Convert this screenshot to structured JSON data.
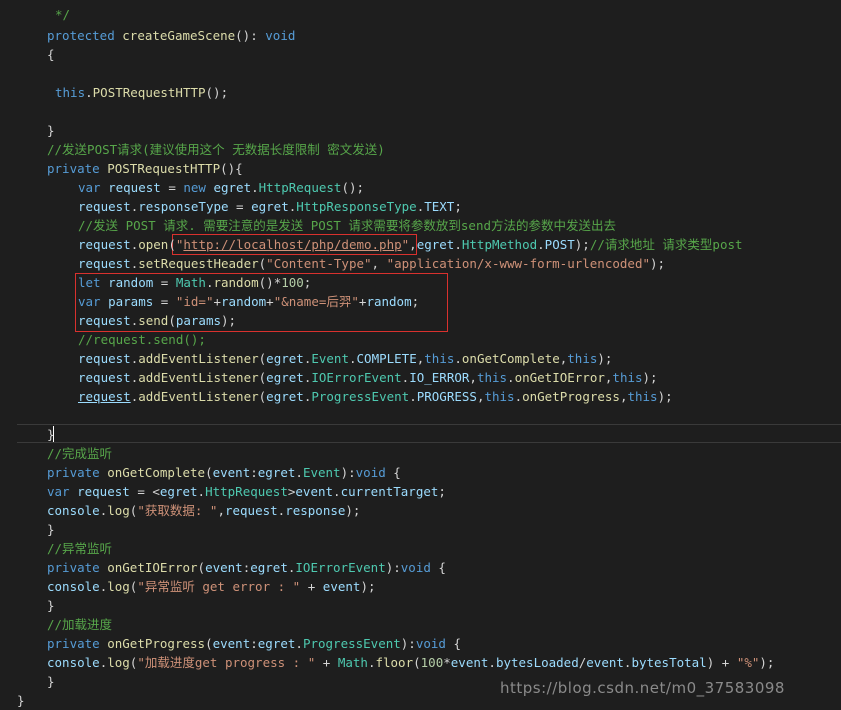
{
  "code": {
    "lines": [
      {
        "tokens": [
          {
            "t": "*/",
            "c": "cm"
          }
        ]
      },
      {
        "tokens": [
          {
            "t": "protected",
            "c": "kw"
          },
          {
            "t": " ",
            "c": "pl"
          },
          {
            "t": "createGameScene",
            "c": "fn"
          },
          {
            "t": "(): ",
            "c": "pl"
          },
          {
            "t": "void",
            "c": "kw"
          }
        ]
      },
      {
        "tokens": [
          {
            "t": "{",
            "c": "pl"
          }
        ]
      },
      {
        "tokens": []
      },
      {
        "tokens": [
          {
            "t": "this",
            "c": "kw"
          },
          {
            "t": ".",
            "c": "pl"
          },
          {
            "t": "POSTRequestHTTP",
            "c": "fn"
          },
          {
            "t": "();",
            "c": "pl"
          }
        ]
      },
      {
        "tokens": []
      },
      {
        "tokens": [
          {
            "t": "}",
            "c": "pl"
          }
        ]
      },
      {
        "tokens": [
          {
            "t": "//发送POST请求(建议使用这个 无数据长度限制 密文发送)",
            "c": "cm"
          }
        ]
      },
      {
        "tokens": [
          {
            "t": "private",
            "c": "kw"
          },
          {
            "t": " ",
            "c": "pl"
          },
          {
            "t": "POSTRequestHTTP",
            "c": "fn"
          },
          {
            "t": "(){",
            "c": "pl"
          }
        ]
      },
      {
        "tokens": [
          {
            "t": "var",
            "c": "kw"
          },
          {
            "t": " ",
            "c": "pl"
          },
          {
            "t": "request",
            "c": "id"
          },
          {
            "t": " = ",
            "c": "pl"
          },
          {
            "t": "new",
            "c": "kw"
          },
          {
            "t": " ",
            "c": "pl"
          },
          {
            "t": "egret",
            "c": "id"
          },
          {
            "t": ".",
            "c": "pl"
          },
          {
            "t": "HttpRequest",
            "c": "ty"
          },
          {
            "t": "();",
            "c": "pl"
          }
        ]
      },
      {
        "tokens": [
          {
            "t": "request",
            "c": "id"
          },
          {
            "t": ".",
            "c": "pl"
          },
          {
            "t": "responseType",
            "c": "id"
          },
          {
            "t": " = ",
            "c": "pl"
          },
          {
            "t": "egret",
            "c": "id"
          },
          {
            "t": ".",
            "c": "pl"
          },
          {
            "t": "HttpResponseType",
            "c": "ty"
          },
          {
            "t": ".",
            "c": "pl"
          },
          {
            "t": "TEXT",
            "c": "id"
          },
          {
            "t": ";",
            "c": "pl"
          }
        ]
      },
      {
        "tokens": [
          {
            "t": "//发送 POST 请求. 需要注意的是发送 POST 请求需要将参数放到send方法的参数中发送出去",
            "c": "cm"
          }
        ]
      },
      {
        "tokens": [
          {
            "t": "request",
            "c": "id"
          },
          {
            "t": ".",
            "c": "pl"
          },
          {
            "t": "open",
            "c": "fn"
          },
          {
            "t": "(",
            "c": "pl"
          },
          {
            "t": "\"",
            "c": "str"
          },
          {
            "t": "http://localhost/php/demo.php",
            "c": "lnk"
          },
          {
            "t": "\"",
            "c": "str"
          },
          {
            "t": ",",
            "c": "pl"
          },
          {
            "t": "egret",
            "c": "id"
          },
          {
            "t": ".",
            "c": "pl"
          },
          {
            "t": "HttpMethod",
            "c": "ty"
          },
          {
            "t": ".",
            "c": "pl"
          },
          {
            "t": "POST",
            "c": "id"
          },
          {
            "t": ");",
            "c": "pl"
          },
          {
            "t": "//请求地址 请求类型post",
            "c": "cm"
          }
        ]
      },
      {
        "tokens": [
          {
            "t": "request",
            "c": "id"
          },
          {
            "t": ".",
            "c": "pl"
          },
          {
            "t": "setRequestHeader",
            "c": "fn"
          },
          {
            "t": "(",
            "c": "pl"
          },
          {
            "t": "\"Content-Type\"",
            "c": "str"
          },
          {
            "t": ", ",
            "c": "pl"
          },
          {
            "t": "\"application/x-www-form-urlencoded\"",
            "c": "str"
          },
          {
            "t": ");",
            "c": "pl"
          }
        ]
      },
      {
        "tokens": [
          {
            "t": "let",
            "c": "kw"
          },
          {
            "t": " ",
            "c": "pl"
          },
          {
            "t": "random",
            "c": "id"
          },
          {
            "t": " = ",
            "c": "pl"
          },
          {
            "t": "Math",
            "c": "ty"
          },
          {
            "t": ".",
            "c": "pl"
          },
          {
            "t": "random",
            "c": "fn"
          },
          {
            "t": "()*",
            "c": "pl"
          },
          {
            "t": "100",
            "c": "num"
          },
          {
            "t": ";",
            "c": "pl"
          }
        ]
      },
      {
        "tokens": [
          {
            "t": "var",
            "c": "kw"
          },
          {
            "t": " ",
            "c": "pl"
          },
          {
            "t": "params",
            "c": "id"
          },
          {
            "t": " = ",
            "c": "pl"
          },
          {
            "t": "\"id=\"",
            "c": "str"
          },
          {
            "t": "+",
            "c": "pl"
          },
          {
            "t": "random",
            "c": "id"
          },
          {
            "t": "+",
            "c": "pl"
          },
          {
            "t": "\"&name=后羿\"",
            "c": "str"
          },
          {
            "t": "+",
            "c": "pl"
          },
          {
            "t": "random",
            "c": "id"
          },
          {
            "t": ";",
            "c": "pl"
          }
        ]
      },
      {
        "tokens": [
          {
            "t": "request",
            "c": "id"
          },
          {
            "t": ".",
            "c": "pl"
          },
          {
            "t": "send",
            "c": "fn"
          },
          {
            "t": "(",
            "c": "pl"
          },
          {
            "t": "params",
            "c": "id"
          },
          {
            "t": ");",
            "c": "pl"
          }
        ]
      },
      {
        "tokens": [
          {
            "t": "//request.send();",
            "c": "cm"
          }
        ]
      },
      {
        "tokens": [
          {
            "t": "request",
            "c": "id"
          },
          {
            "t": ".",
            "c": "pl"
          },
          {
            "t": "addEventListener",
            "c": "fn"
          },
          {
            "t": "(",
            "c": "pl"
          },
          {
            "t": "egret",
            "c": "id"
          },
          {
            "t": ".",
            "c": "pl"
          },
          {
            "t": "Event",
            "c": "ty"
          },
          {
            "t": ".",
            "c": "pl"
          },
          {
            "t": "COMPLETE",
            "c": "id"
          },
          {
            "t": ",",
            "c": "pl"
          },
          {
            "t": "this",
            "c": "kw"
          },
          {
            "t": ".",
            "c": "pl"
          },
          {
            "t": "onGetComplete",
            "c": "fn"
          },
          {
            "t": ",",
            "c": "pl"
          },
          {
            "t": "this",
            "c": "kw"
          },
          {
            "t": ");",
            "c": "pl"
          }
        ]
      },
      {
        "tokens": [
          {
            "t": "request",
            "c": "id"
          },
          {
            "t": ".",
            "c": "pl"
          },
          {
            "t": "addEventListener",
            "c": "fn"
          },
          {
            "t": "(",
            "c": "pl"
          },
          {
            "t": "egret",
            "c": "id"
          },
          {
            "t": ".",
            "c": "pl"
          },
          {
            "t": "IOErrorEvent",
            "c": "ty"
          },
          {
            "t": ".",
            "c": "pl"
          },
          {
            "t": "IO_ERROR",
            "c": "id"
          },
          {
            "t": ",",
            "c": "pl"
          },
          {
            "t": "this",
            "c": "kw"
          },
          {
            "t": ".",
            "c": "pl"
          },
          {
            "t": "onGetIOError",
            "c": "fn"
          },
          {
            "t": ",",
            "c": "pl"
          },
          {
            "t": "this",
            "c": "kw"
          },
          {
            "t": ");",
            "c": "pl"
          }
        ]
      },
      {
        "tokens": [
          {
            "t": "request",
            "c": "ul"
          },
          {
            "t": ".",
            "c": "pl"
          },
          {
            "t": "addEventListener",
            "c": "fn"
          },
          {
            "t": "(",
            "c": "pl"
          },
          {
            "t": "egret",
            "c": "id"
          },
          {
            "t": ".",
            "c": "pl"
          },
          {
            "t": "ProgressEvent",
            "c": "ty"
          },
          {
            "t": ".",
            "c": "pl"
          },
          {
            "t": "PROGRESS",
            "c": "id"
          },
          {
            "t": ",",
            "c": "pl"
          },
          {
            "t": "this",
            "c": "kw"
          },
          {
            "t": ".",
            "c": "pl"
          },
          {
            "t": "onGetProgress",
            "c": "fn"
          },
          {
            "t": ",",
            "c": "pl"
          },
          {
            "t": "this",
            "c": "kw"
          },
          {
            "t": ");",
            "c": "pl"
          }
        ]
      },
      {
        "tokens": []
      },
      {
        "tokens": [
          {
            "t": "}",
            "c": "pl"
          }
        ]
      },
      {
        "tokens": [
          {
            "t": "//完成监听",
            "c": "cm"
          }
        ]
      },
      {
        "tokens": [
          {
            "t": "private",
            "c": "kw"
          },
          {
            "t": " ",
            "c": "pl"
          },
          {
            "t": "onGetComplete",
            "c": "fn"
          },
          {
            "t": "(",
            "c": "pl"
          },
          {
            "t": "event",
            "c": "id"
          },
          {
            "t": ":",
            "c": "pl"
          },
          {
            "t": "egret",
            "c": "id"
          },
          {
            "t": ".",
            "c": "pl"
          },
          {
            "t": "Event",
            "c": "ty"
          },
          {
            "t": "):",
            "c": "pl"
          },
          {
            "t": "void",
            "c": "kw"
          },
          {
            "t": " {",
            "c": "pl"
          }
        ]
      },
      {
        "tokens": [
          {
            "t": "var",
            "c": "kw"
          },
          {
            "t": " ",
            "c": "pl"
          },
          {
            "t": "request",
            "c": "id"
          },
          {
            "t": " = <",
            "c": "pl"
          },
          {
            "t": "egret",
            "c": "id"
          },
          {
            "t": ".",
            "c": "pl"
          },
          {
            "t": "HttpRequest",
            "c": "ty"
          },
          {
            "t": ">",
            "c": "pl"
          },
          {
            "t": "event",
            "c": "id"
          },
          {
            "t": ".",
            "c": "pl"
          },
          {
            "t": "currentTarget",
            "c": "id"
          },
          {
            "t": ";",
            "c": "pl"
          }
        ]
      },
      {
        "tokens": [
          {
            "t": "console",
            "c": "id"
          },
          {
            "t": ".",
            "c": "pl"
          },
          {
            "t": "log",
            "c": "fn"
          },
          {
            "t": "(",
            "c": "pl"
          },
          {
            "t": "\"获取数据: \"",
            "c": "str"
          },
          {
            "t": ",",
            "c": "pl"
          },
          {
            "t": "request",
            "c": "id"
          },
          {
            "t": ".",
            "c": "pl"
          },
          {
            "t": "response",
            "c": "id"
          },
          {
            "t": ");",
            "c": "pl"
          }
        ]
      },
      {
        "tokens": [
          {
            "t": "}",
            "c": "pl"
          }
        ]
      },
      {
        "tokens": [
          {
            "t": "//异常监听",
            "c": "cm"
          }
        ]
      },
      {
        "tokens": [
          {
            "t": "private",
            "c": "kw"
          },
          {
            "t": " ",
            "c": "pl"
          },
          {
            "t": "onGetIOError",
            "c": "fn"
          },
          {
            "t": "(",
            "c": "pl"
          },
          {
            "t": "event",
            "c": "id"
          },
          {
            "t": ":",
            "c": "pl"
          },
          {
            "t": "egret",
            "c": "id"
          },
          {
            "t": ".",
            "c": "pl"
          },
          {
            "t": "IOErrorEvent",
            "c": "ty"
          },
          {
            "t": "):",
            "c": "pl"
          },
          {
            "t": "void",
            "c": "kw"
          },
          {
            "t": " {",
            "c": "pl"
          }
        ]
      },
      {
        "tokens": [
          {
            "t": "console",
            "c": "id"
          },
          {
            "t": ".",
            "c": "pl"
          },
          {
            "t": "log",
            "c": "fn"
          },
          {
            "t": "(",
            "c": "pl"
          },
          {
            "t": "\"异常监听 get error : \"",
            "c": "str"
          },
          {
            "t": " + ",
            "c": "pl"
          },
          {
            "t": "event",
            "c": "id"
          },
          {
            "t": ");",
            "c": "pl"
          }
        ]
      },
      {
        "tokens": [
          {
            "t": "}",
            "c": "pl"
          }
        ]
      },
      {
        "tokens": [
          {
            "t": "//加载进度",
            "c": "cm"
          }
        ]
      },
      {
        "tokens": [
          {
            "t": "private",
            "c": "kw"
          },
          {
            "t": " ",
            "c": "pl"
          },
          {
            "t": "onGetProgress",
            "c": "fn"
          },
          {
            "t": "(",
            "c": "pl"
          },
          {
            "t": "event",
            "c": "id"
          },
          {
            "t": ":",
            "c": "pl"
          },
          {
            "t": "egret",
            "c": "id"
          },
          {
            "t": ".",
            "c": "pl"
          },
          {
            "t": "ProgressEvent",
            "c": "ty"
          },
          {
            "t": "):",
            "c": "pl"
          },
          {
            "t": "void",
            "c": "kw"
          },
          {
            "t": " {",
            "c": "pl"
          }
        ]
      },
      {
        "tokens": [
          {
            "t": "console",
            "c": "id"
          },
          {
            "t": ".",
            "c": "pl"
          },
          {
            "t": "log",
            "c": "fn"
          },
          {
            "t": "(",
            "c": "pl"
          },
          {
            "t": "\"加载进度get progress : \"",
            "c": "str"
          },
          {
            "t": " + ",
            "c": "pl"
          },
          {
            "t": "Math",
            "c": "ty"
          },
          {
            "t": ".",
            "c": "pl"
          },
          {
            "t": "floor",
            "c": "fn"
          },
          {
            "t": "(",
            "c": "pl"
          },
          {
            "t": "100",
            "c": "num"
          },
          {
            "t": "*",
            "c": "pl"
          },
          {
            "t": "event",
            "c": "id"
          },
          {
            "t": ".",
            "c": "pl"
          },
          {
            "t": "bytesLoaded",
            "c": "id"
          },
          {
            "t": "/",
            "c": "pl"
          },
          {
            "t": "event",
            "c": "id"
          },
          {
            "t": ".",
            "c": "pl"
          },
          {
            "t": "bytesTotal",
            "c": "id"
          },
          {
            "t": ") + ",
            "c": "pl"
          },
          {
            "t": "\"%\"",
            "c": "str"
          },
          {
            "t": ");",
            "c": "pl"
          }
        ]
      },
      {
        "tokens": [
          {
            "t": "}",
            "c": "pl"
          }
        ]
      },
      {
        "tokens": [
          {
            "t": "}",
            "c": "pl"
          }
        ]
      }
    ]
  },
  "watermark": "https://blog.csdn.net/m0_37583098",
  "colors": {
    "background": "#1e1e1e",
    "keyword": "#569cd6",
    "function": "#dcdcaa",
    "identifier": "#9cdcfe",
    "type": "#4ec9b0",
    "string": "#ce9178",
    "comment": "#57a64a",
    "number": "#b5cea8",
    "highlight_box": "#d9312e"
  }
}
